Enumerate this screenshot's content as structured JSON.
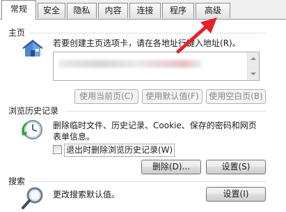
{
  "tabs": [
    {
      "label": "常规",
      "active": true
    },
    {
      "label": "安全",
      "active": false
    },
    {
      "label": "隐私",
      "active": false
    },
    {
      "label": "内容",
      "active": false
    },
    {
      "label": "连接",
      "active": false
    },
    {
      "label": "程序",
      "active": false
    },
    {
      "label": "高级",
      "active": false
    }
  ],
  "homepage": {
    "title": "主页",
    "description": "若要创建主页选项卡，请在各地址行键入地址(R)。",
    "icon": "house-icon",
    "buttons": {
      "use_current": "使用当前页(C)",
      "use_default": "使用默认值(F)",
      "use_blank": "使用空白页(B)"
    }
  },
  "history": {
    "title": "浏览历史记录",
    "description_line1": "删除临时文件、历史记录、Cookie、保存的密码和网页",
    "description_line2": "表单信息。",
    "icon": "history-clock-icon",
    "checkbox_label": "退出时删除浏览历史记录(W)",
    "checkbox_checked": false,
    "delete_button": "删除(D)...",
    "settings_button": "设置(S)"
  },
  "search": {
    "title": "搜索",
    "description": "更改搜索默认值。",
    "icon": "magnifier-icon",
    "settings_button": "设置(I)"
  },
  "annotation": {
    "icon": "red-arrow-icon",
    "color": "#e8202a"
  }
}
